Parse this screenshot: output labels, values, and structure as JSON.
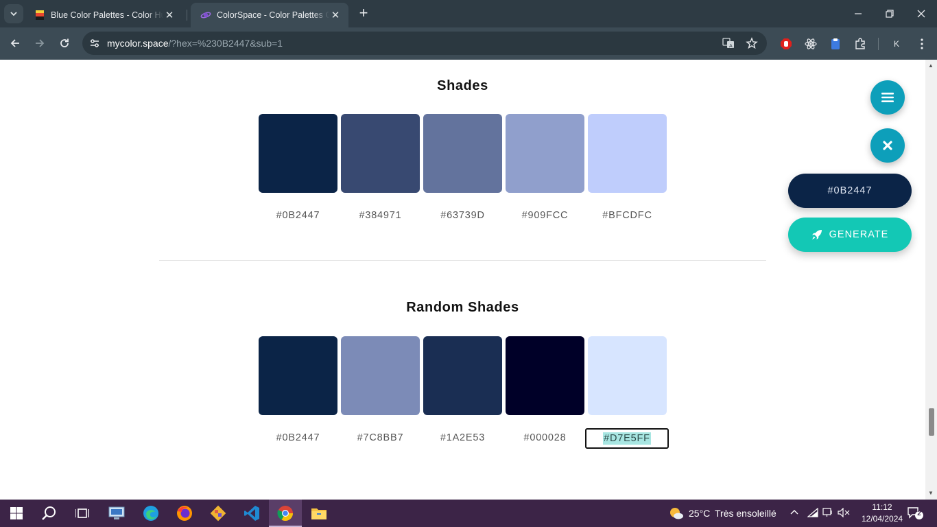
{
  "browser": {
    "tabs": [
      {
        "title": "Blue Color Palettes - Color Hunt",
        "active": false
      },
      {
        "title": "ColorSpace - Color Palettes Generator",
        "active": true
      }
    ],
    "address": {
      "host": "mycolor.space",
      "path": "/?hex=%230B2447&sub=1"
    },
    "profile_initial": "K"
  },
  "sections": [
    {
      "title": "Shades",
      "swatches": [
        {
          "hex": "#0B2447",
          "color": "#0B2447"
        },
        {
          "hex": "#384971",
          "color": "#384971"
        },
        {
          "hex": "#63739D",
          "color": "#63739D"
        },
        {
          "hex": "#909FCC",
          "color": "#909FCC"
        },
        {
          "hex": "#BFCDFC",
          "color": "#BFCDFC"
        }
      ]
    },
    {
      "title": "Random Shades",
      "swatches": [
        {
          "hex": "#0B2447",
          "color": "#0B2447"
        },
        {
          "hex": "#7C8BB7",
          "color": "#7C8BB7"
        },
        {
          "hex": "#1A2E53",
          "color": "#1A2E53"
        },
        {
          "hex": "#000028",
          "color": "#000028"
        },
        {
          "hex": "#D7E5FF",
          "color": "#D7E5FF",
          "selected": true
        }
      ]
    }
  ],
  "floating": {
    "current_hex": "#0B2447",
    "generate_label": "GENERATE",
    "accent": "#13C8B5",
    "fab_color": "#0D9FBA"
  },
  "taskbar": {
    "weather_temp": "25°C",
    "weather_text": "Très ensoleillé",
    "time": "11:12",
    "date": "12/04/2024",
    "notifications": "2"
  }
}
